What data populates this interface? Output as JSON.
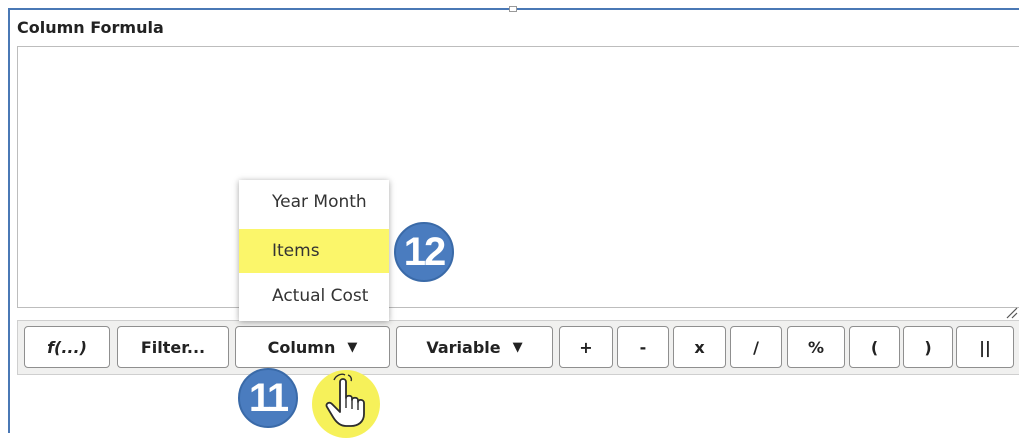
{
  "panel": {
    "title": "Column Formula"
  },
  "toolbar": {
    "buttons": [
      {
        "label": "f(...)"
      },
      {
        "label": "Filter..."
      },
      {
        "label": "Column",
        "caret": "▼"
      },
      {
        "label": "Variable",
        "caret": "▼"
      },
      {
        "label": "+"
      },
      {
        "label": "-"
      },
      {
        "label": "x"
      },
      {
        "label": "/"
      },
      {
        "label": "%"
      },
      {
        "label": "("
      },
      {
        "label": ")"
      },
      {
        "label": "||"
      }
    ]
  },
  "column_menu": {
    "items": [
      {
        "label": "Year Month",
        "highlighted": false
      },
      {
        "label": "Items",
        "highlighted": true
      },
      {
        "label": "Actual Cost",
        "highlighted": false
      }
    ]
  },
  "callouts": {
    "step_11": "11",
    "step_12": "12"
  },
  "pointer": {
    "icon": "hand-pointer-icon"
  },
  "colors": {
    "highlight": "#fbf66a",
    "badge": "#4a7cbf",
    "frame": "#4a78b5"
  }
}
